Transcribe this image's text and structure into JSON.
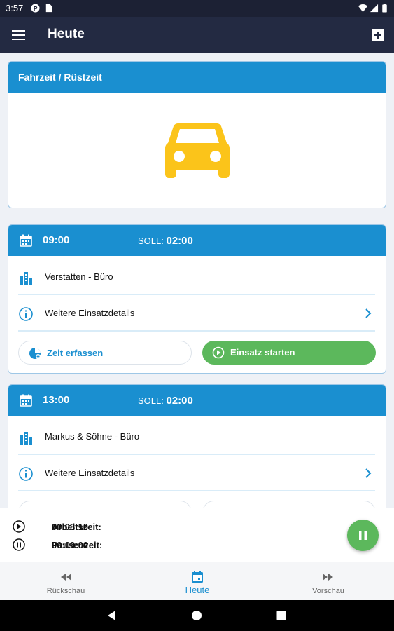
{
  "status_bar": {
    "time": "3:57",
    "icons": [
      "circle-p-icon",
      "sim-card-icon",
      "wifi-icon",
      "signal-icon",
      "battery-icon"
    ]
  },
  "app_bar": {
    "title": "Heute",
    "menu_icon": "hamburger-menu-icon",
    "add_icon": "add-box-icon"
  },
  "travel_card": {
    "title": "Fahrzeit / Rüstzeit",
    "icon": "car-icon",
    "icon_color": "#fbc41a"
  },
  "appointments": [
    {
      "time": "09:00",
      "soll_label": "SOLL:",
      "soll_value": "02:00",
      "location": "Verstatten - Büro",
      "details_label": "Weitere Einsatzdetails",
      "record_time_label": "Zeit erfassen",
      "start_label": "Einsatz starten"
    },
    {
      "time": "13:00",
      "soll_label": "SOLL:",
      "soll_value": "02:00",
      "location": "Markus & Söhne - Büro",
      "details_label": "Weitere Einsatzdetails"
    }
  ],
  "timers": {
    "work_label": "Arbeitszeit:",
    "work_value": "00:03:10",
    "pause_label": "Pausenzeit:",
    "pause_value": "00:00:00"
  },
  "fab_icon": "pause-icon",
  "tabs": [
    {
      "label": "Rückschau",
      "icon": "rewind-icon"
    },
    {
      "label": "Heute",
      "icon": "calendar-icon",
      "active": true
    },
    {
      "label": "Vorschau",
      "icon": "fast-forward-icon"
    }
  ],
  "colors": {
    "header_blue": "#1a8fd0",
    "app_bar": "#232a42",
    "accent_green": "#5cb85c",
    "car_yellow": "#fbc41a"
  }
}
